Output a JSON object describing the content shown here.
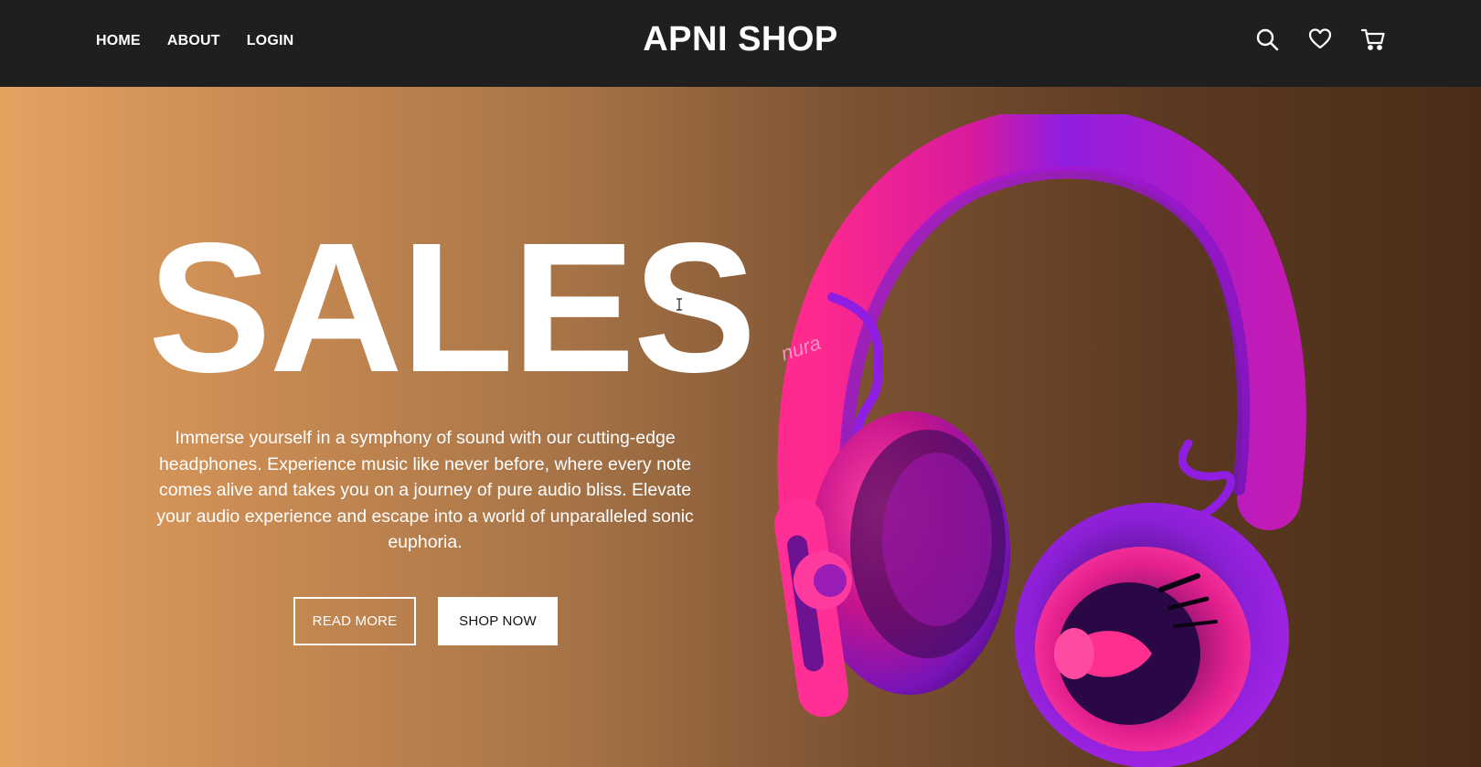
{
  "nav": {
    "links": [
      {
        "label": "HOME"
      },
      {
        "label": "ABOUT"
      },
      {
        "label": "LOGIN"
      }
    ],
    "brand": "APNI SHOP",
    "icons": [
      "search-icon",
      "heart-icon",
      "cart-icon"
    ]
  },
  "hero": {
    "title": "SALES",
    "description": "Immerse yourself in a symphony of sound with our cutting-edge headphones. Experience music like never before, where every note comes alive and takes you on a journey of pure audio bliss. Elevate your audio experience and escape into a world of unparalleled sonic euphoria.",
    "read_more_label": "READ MORE",
    "shop_now_label": "SHOP NOW",
    "product_brand": "nura"
  },
  "colors": {
    "navbar": "#1f1f1f",
    "gradient_start": "#e5a261",
    "gradient_end": "#4a2c18",
    "headphone_pink": "#ff1f8c",
    "headphone_purple": "#8a18e0"
  }
}
